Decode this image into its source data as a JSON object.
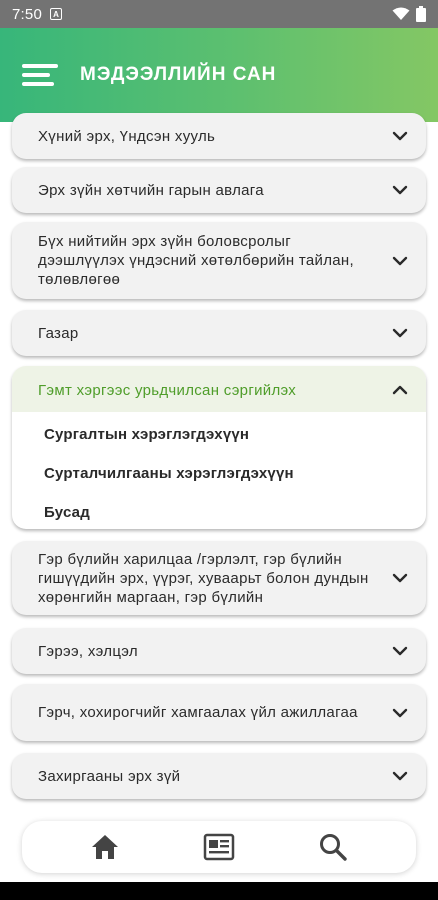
{
  "status_bar": {
    "time": "7:50",
    "notification_icon": "a-notification-icon",
    "wifi_icon": "wifi-icon",
    "battery_icon": "battery-icon"
  },
  "app_bar": {
    "title": "МЭДЭЭЛЛИЙН САН",
    "menu_icon": "hamburger-menu-icon"
  },
  "categories": [
    {
      "title": "Хүний эрх, Үндсэн хууль"
    },
    {
      "title": "Эрх зүйн хөтчийн гарын авлага"
    },
    {
      "title": "Бүх нийтийн эрх зүйн боловсролыг дээшлүүлэх үндэсний хөтөлбөрийн тайлан, төлөвлөгөө"
    },
    {
      "title": "Газар"
    },
    {
      "title": "Гэмт хэргээс урьдчилсан сэргийлэх",
      "expanded": true,
      "items": [
        "Сургалтын хэрэглэгдэхүүн",
        "Сурталчилгааны хэрэглэгдэхүүн",
        "Бусад"
      ]
    },
    {
      "title": "Гэр бүлийн харилцаа /гэрлэлт, гэр бүлийн гишүүдийн эрх, үүрэг, хуваарьт болон дундын хөрөнгийн маргаан, гэр бүлийн"
    },
    {
      "title": "Гэрээ, хэлцэл"
    },
    {
      "title": "Гэрч, хохирогчийг хамгаалах үйл ажиллагаа"
    },
    {
      "title": "Захиргааны эрх зүй"
    }
  ],
  "bottom_nav": [
    {
      "icon": "home-icon"
    },
    {
      "icon": "news-icon"
    },
    {
      "icon": "search-icon"
    }
  ],
  "colors": {
    "accent_green": "#4f9d2a",
    "header_start": "#37b67a",
    "header_end": "#84c764"
  }
}
